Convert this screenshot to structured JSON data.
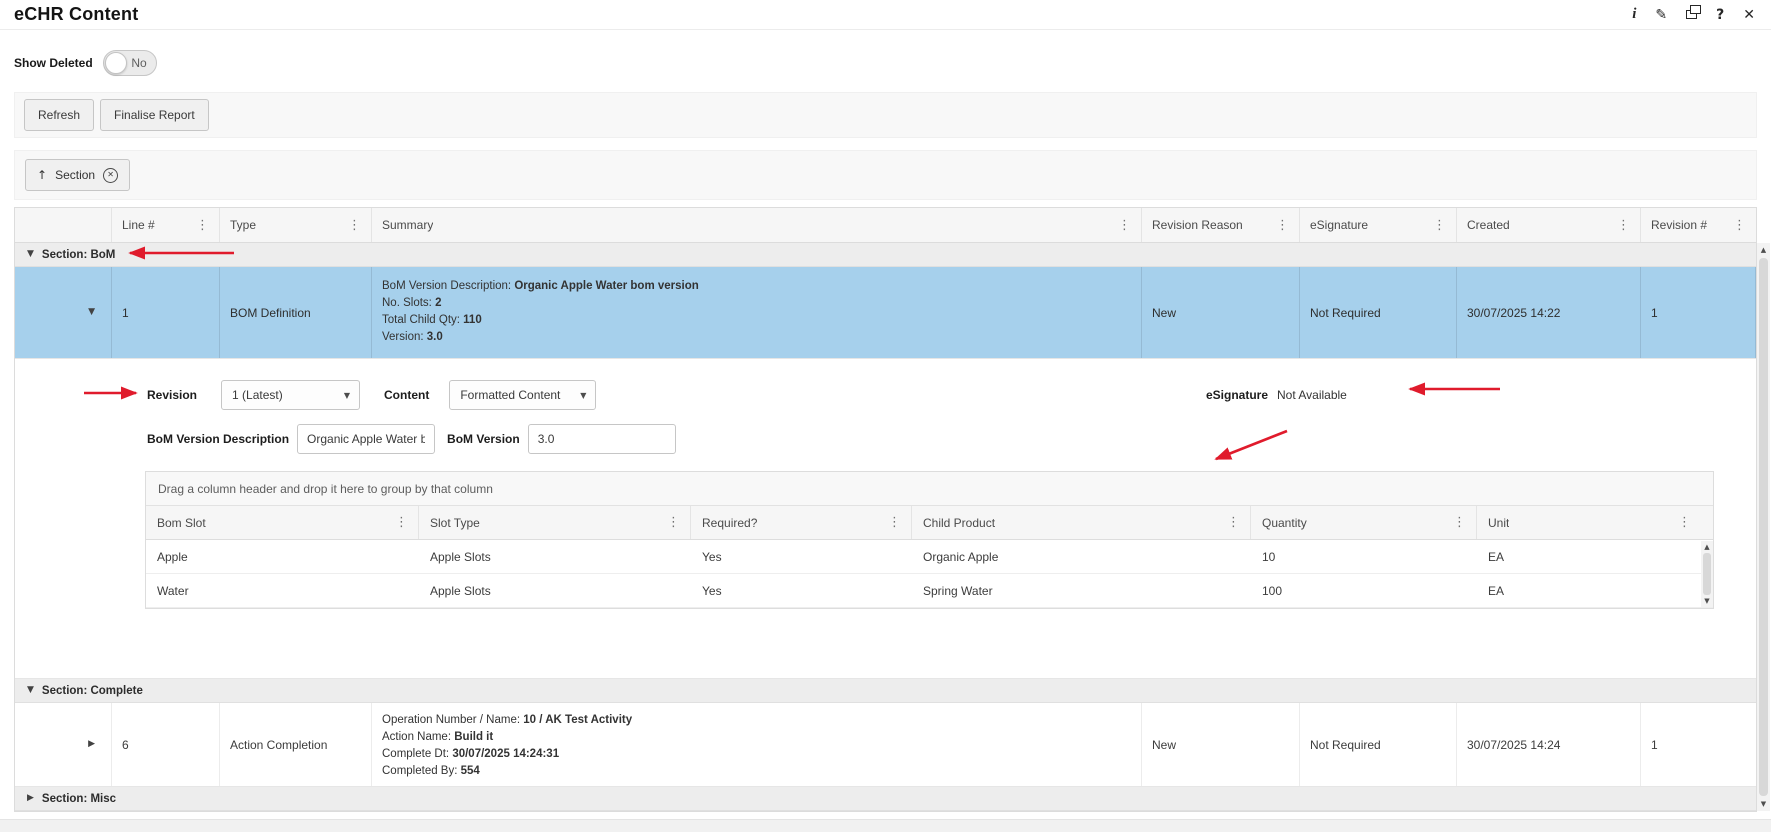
{
  "titlebar": {
    "title": "eCHR Content"
  },
  "icons": {
    "info": "i",
    "edit": "✎",
    "help": "?",
    "close": "✕",
    "remove": "✕",
    "sort_asc": "↑",
    "kebab": "⋮",
    "collapse": "▼",
    "expand": "▶",
    "dropdown": "▼",
    "scroll_up": "▲",
    "scroll_down": "▼"
  },
  "toolbar": {
    "show_deleted_label": "Show Deleted",
    "toggle_value": "No",
    "refresh_label": "Refresh",
    "finalise_label": "Finalise Report"
  },
  "grouping": {
    "chip_label": "Section"
  },
  "grid": {
    "columns": {
      "line": "Line #",
      "type": "Type",
      "summary": "Summary",
      "revision_reason": "Revision Reason",
      "esignature": "eSignature",
      "created": "Created",
      "revision_no": "Revision #"
    },
    "group_bom": {
      "label": "Section: BoM"
    },
    "bom_row": {
      "line": "1",
      "type": "BOM Definition",
      "summary": [
        {
          "label": "BoM Version Description: ",
          "value": "Organic Apple Water bom version"
        },
        {
          "label": "No. Slots: ",
          "value": "2"
        },
        {
          "label": "Total Child Qty: ",
          "value": "110"
        },
        {
          "label": "Version: ",
          "value": "3.0"
        }
      ],
      "revision_reason": "New",
      "esignature": "Not Required",
      "created": "30/07/2025 14:22",
      "revision_no": "1"
    },
    "detail": {
      "revision_label": "Revision",
      "revision_value": "1 (Latest)",
      "content_label": "Content",
      "content_value": "Formatted Content",
      "esignature_label": "eSignature",
      "esignature_value": "Not Available",
      "bom_desc_label": "BoM Version Description",
      "bom_desc_value": "Organic Apple Water b...",
      "bom_version_label": "BoM Version",
      "bom_version_value": "3.0",
      "inner_grid": {
        "drag_hint": "Drag a column header and drop it here to group by that column",
        "columns": {
          "bom_slot": "Bom Slot",
          "slot_type": "Slot Type",
          "required": "Required?",
          "child_product": "Child Product",
          "quantity": "Quantity",
          "unit": "Unit"
        },
        "rows": [
          {
            "bom_slot": "Apple",
            "slot_type": "Apple Slots",
            "required": "Yes",
            "child_product": "Organic Apple",
            "quantity": "10",
            "unit": "EA"
          },
          {
            "bom_slot": "Water",
            "slot_type": "Apple Slots",
            "required": "Yes",
            "child_product": "Spring Water",
            "quantity": "100",
            "unit": "EA"
          }
        ]
      }
    },
    "group_complete": {
      "label": "Section: Complete"
    },
    "complete_row": {
      "line": "6",
      "type": "Action Completion",
      "summary": [
        {
          "label": "Operation Number / Name: ",
          "value": "10 / AK Test Activity"
        },
        {
          "label": "Action Name: ",
          "value": "Build it"
        },
        {
          "label": "Complete Dt: ",
          "value": "30/07/2025 14:24:31"
        },
        {
          "label": "Completed By: ",
          "value": "554"
        }
      ],
      "revision_reason": "New",
      "esignature": "Not Required",
      "created": "30/07/2025 14:24",
      "revision_no": "1"
    },
    "group_misc": {
      "label": "Section: Misc"
    }
  },
  "colors": {
    "selected_row": "#a6d0ec",
    "annotation": "#e01b2c"
  }
}
